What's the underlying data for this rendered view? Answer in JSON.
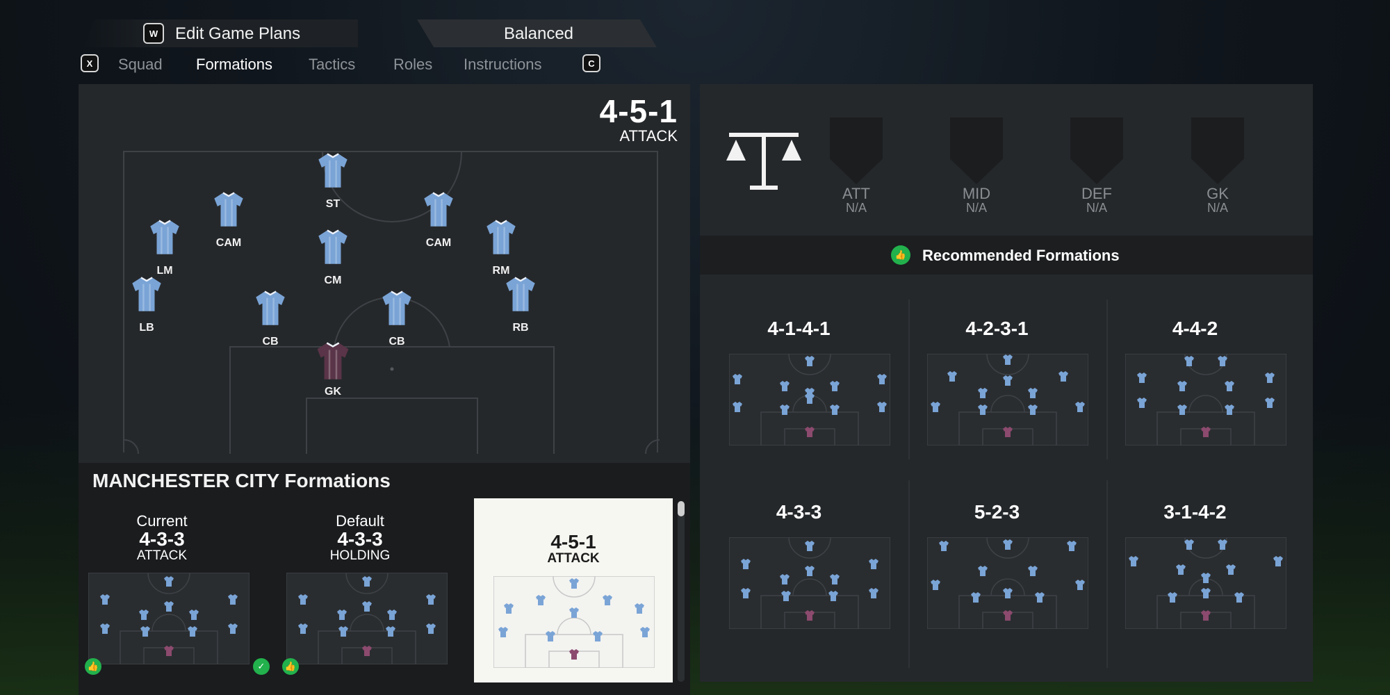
{
  "game_plan_bar": {
    "edit_key": "W",
    "edit_label": "Edit Game Plans",
    "plan_value": "Balanced"
  },
  "nav": {
    "prev_key": "X",
    "next_key": "C",
    "tabs": [
      {
        "label": "Squad",
        "active": false
      },
      {
        "label": "Formations",
        "active": true
      },
      {
        "label": "Tactics",
        "active": false
      },
      {
        "label": "Roles",
        "active": false
      },
      {
        "label": "Instructions",
        "active": false
      }
    ]
  },
  "current_formation": {
    "name": "4-5-1",
    "style": "ATTACK",
    "players": [
      {
        "pos": "ST"
      },
      {
        "pos": "CAM"
      },
      {
        "pos": "CAM"
      },
      {
        "pos": "LM"
      },
      {
        "pos": "CM"
      },
      {
        "pos": "RM"
      },
      {
        "pos": "LB"
      },
      {
        "pos": "CB"
      },
      {
        "pos": "CB"
      },
      {
        "pos": "RB"
      },
      {
        "pos": "GK"
      }
    ]
  },
  "team_formations": {
    "title": "MANCHESTER CITY Formations",
    "cards": [
      {
        "label": "Current",
        "formation": "4-3-3",
        "style": "ATTACK",
        "recommended": true,
        "active": true
      },
      {
        "label": "Default",
        "formation": "4-3-3",
        "style": "HOLDING",
        "recommended": true,
        "active": false
      },
      {
        "label": "",
        "formation": "4-5-1",
        "style": "ATTACK",
        "recommended": false,
        "active": false,
        "selected": true
      }
    ]
  },
  "ratings": [
    {
      "label": "ATT",
      "value": "N/A"
    },
    {
      "label": "MID",
      "value": "N/A"
    },
    {
      "label": "DEF",
      "value": "N/A"
    },
    {
      "label": "GK",
      "value": "N/A"
    }
  ],
  "recommended": {
    "title": "Recommended Formations",
    "items": [
      "4-1-4-1",
      "4-2-3-1",
      "4-4-2",
      "4-3-3",
      "5-2-3",
      "3-1-4-2"
    ]
  },
  "icons": {
    "balance": "scales-icon",
    "recommend": "thumbs-up-icon",
    "active": "checkmark-icon"
  },
  "colors": {
    "kit": "#7aa4d6",
    "gk_kit": "#5a3448",
    "recommend_green": "#22b14c",
    "panel": "#25282b"
  }
}
